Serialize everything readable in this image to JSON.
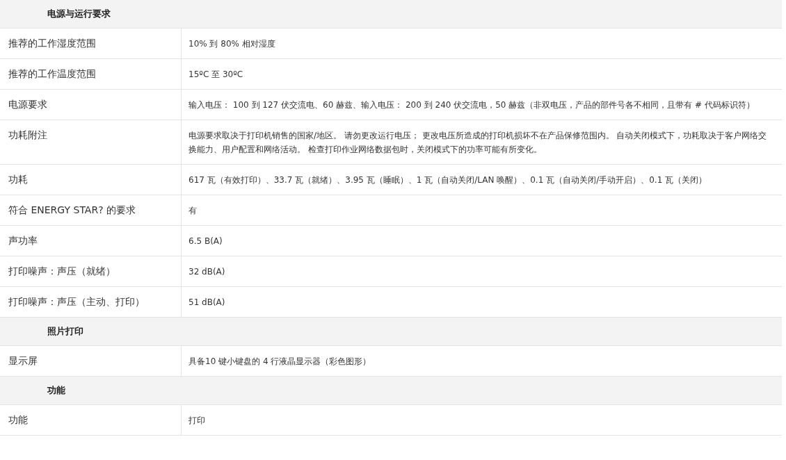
{
  "sections": [
    {
      "title": "电源与运行要求",
      "rows": [
        {
          "label": "推荐的工作湿度范围",
          "value": "10% 到 80% 相对湿度"
        },
        {
          "label": "推荐的工作温度范围",
          "value": "15ºC 至 30ºC"
        },
        {
          "label": "电源要求",
          "value": "输入电压： 100 到 127 伏交流电、60 赫兹、输入电压： 200 到 240 伏交流电，50 赫兹（非双电压，产品的部件号各不相同，且带有 # 代码标识符）"
        },
        {
          "label": "功耗附注",
          "value": "电源要求取决于打印机销售的国家/地区。 请勿更改运行电压； 更改电压所造成的打印机损坏不在产品保修范围内。 自动关闭模式下，功耗取决于客户网络交换能力、用户配置和网络活动。 检查打印作业网络数据包时，关闭模式下的功率可能有所变化。"
        },
        {
          "label": "功耗",
          "value": "617 瓦（有效打印）、33.7 瓦（就绪）、3.95 瓦（睡眠）、1 瓦（自动关闭/LAN 唤醒）、0.1 瓦（自动关闭/手动开启）、0.1 瓦（关闭）"
        },
        {
          "label": "符合 ENERGY STAR? 的要求",
          "value": "有"
        },
        {
          "label": "声功率",
          "value": "6.5 B(A)"
        },
        {
          "label": "打印噪声：声压（就绪）",
          "value": "32 dB(A)"
        },
        {
          "label": "打印噪声：声压（主动、打印）",
          "value": "51 dB(A)"
        }
      ]
    },
    {
      "title": "照片打印",
      "rows": [
        {
          "label": "显示屏",
          "value": "具备10 键小键盘的 4 行液晶显示器（彩色图形）"
        }
      ]
    },
    {
      "title": "功能",
      "rows": [
        {
          "label": "功能",
          "value": "打印"
        }
      ]
    }
  ]
}
